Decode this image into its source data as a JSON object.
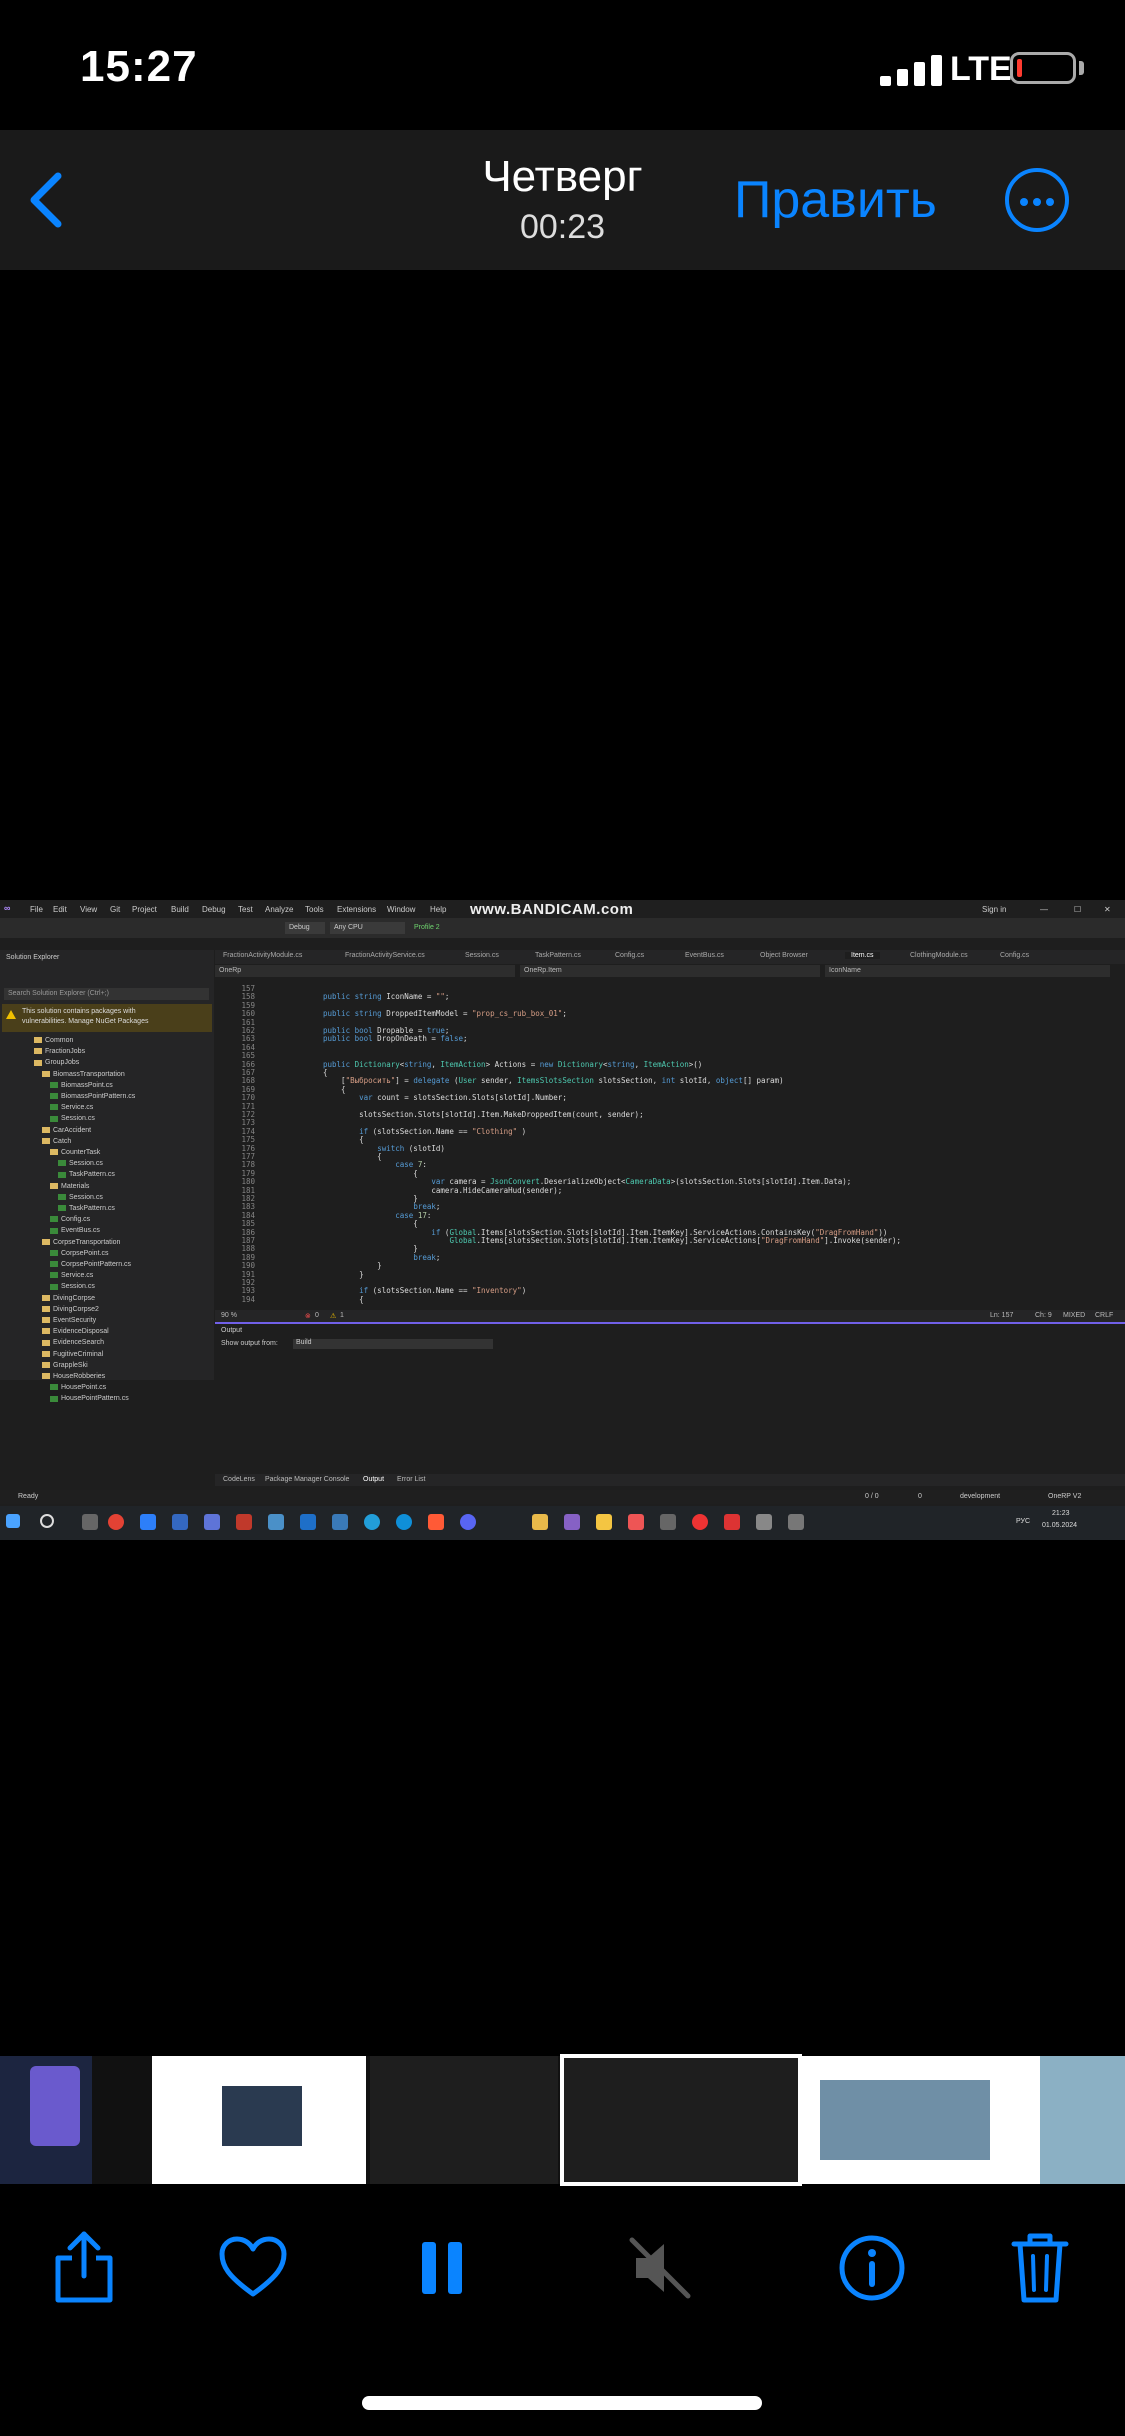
{
  "status": {
    "time": "15:27",
    "network": "LTE"
  },
  "nav": {
    "title": "Четверг",
    "subtitle": "00:23",
    "edit_label": "Править"
  },
  "video": {
    "watermark": "www.BANDICAM.com",
    "menu": [
      "File",
      "Edit",
      "View",
      "Git",
      "Project",
      "Build",
      "Debug",
      "Test",
      "Analyze",
      "Tools",
      "Extensions",
      "Window",
      "Help"
    ],
    "sign_in": "Sign in",
    "toolbar": {
      "config": "Debug",
      "platform": "Any CPU",
      "profile": "Profile 2"
    },
    "tabs": [
      "FractionActivityModule.cs",
      "FractionActivityService.cs",
      "Session.cs",
      "TaskPattern.cs",
      "Config.cs",
      "EventBus.cs",
      "Object Browser",
      "Item.cs",
      "ClothingModule.cs",
      "Config.cs"
    ],
    "active_tab": "Item.cs",
    "nav_dropdowns": [
      "OneRp",
      "OneRp.Item",
      "IconName"
    ],
    "solution": {
      "title": "Solution Explorer",
      "search": "Search Solution Explorer (Ctrl+;)",
      "warning_line1": "This solution contains packages with",
      "warning_line2": "vulnerabilities. Manage NuGet Packages",
      "items": [
        "Common",
        "FractionJobs",
        "GroupJobs",
        "BiomassTransportation",
        "BiomassPoint.cs",
        "BiomassPointPattern.cs",
        "Service.cs",
        "Session.cs",
        "CarAccident",
        "Catch",
        "CounterTask",
        "Session.cs",
        "TaskPattern.cs",
        "Materials",
        "Session.cs",
        "TaskPattern.cs",
        "Config.cs",
        "EventBus.cs",
        "CorpseTransportation",
        "CorpsePoint.cs",
        "CorpsePointPattern.cs",
        "Service.cs",
        "Session.cs",
        "DivingCorpse",
        "DivingCorpse2",
        "EventSecurity",
        "EvidenceDisposal",
        "EvidenceSearch",
        "FugitiveCriminal",
        "GrappleSki",
        "HouseRobberies",
        "HousePoint.cs",
        "HousePointPattern.cs"
      ]
    },
    "code": [
      {
        "ln": "157",
        "t": ""
      },
      {
        "ln": "158",
        "t": "public string IconName = \"\";"
      },
      {
        "ln": "159",
        "t": ""
      },
      {
        "ln": "160",
        "t": "public string DroppedItemModel = \"prop_cs_rub_box_01\";"
      },
      {
        "ln": "161",
        "t": ""
      },
      {
        "ln": "162",
        "t": "public bool Dropable = true;"
      },
      {
        "ln": "163",
        "t": "public bool DropOnDeath = false;"
      },
      {
        "ln": "164",
        "t": ""
      },
      {
        "ln": "165",
        "t": ""
      },
      {
        "ln": "166",
        "t": "public Dictionary<string, ItemAction> Actions = new Dictionary<string, ItemAction>()"
      },
      {
        "ln": "167",
        "t": "{"
      },
      {
        "ln": "168",
        "t": "    [\"Выбросить\"] = delegate (User sender, ItemsSlotsSection slotsSection, int slotId, object[] param)"
      },
      {
        "ln": "169",
        "t": "    {"
      },
      {
        "ln": "170",
        "t": "        var count = slotsSection.Slots[slotId].Number;"
      },
      {
        "ln": "171",
        "t": ""
      },
      {
        "ln": "172",
        "t": "        slotsSection.Slots[slotId].Item.MakeDroppedItem(count, sender);"
      },
      {
        "ln": "173",
        "t": ""
      },
      {
        "ln": "174",
        "t": "        if (slotsSection.Name == \"Clothing\" )"
      },
      {
        "ln": "175",
        "t": "        {"
      },
      {
        "ln": "176",
        "t": "            switch (slotId)"
      },
      {
        "ln": "177",
        "t": "            {"
      },
      {
        "ln": "178",
        "t": "                case 7:"
      },
      {
        "ln": "179",
        "t": "                    {"
      },
      {
        "ln": "180",
        "t": "                        var camera = JsonConvert.DeserializeObject<CameraData>(slotsSection.Slots[slotId].Item.Data);"
      },
      {
        "ln": "181",
        "t": "                        camera.HideCameraHud(sender);"
      },
      {
        "ln": "182",
        "t": "                    }"
      },
      {
        "ln": "183",
        "t": "                    break;"
      },
      {
        "ln": "184",
        "t": "                case 17:"
      },
      {
        "ln": "185",
        "t": "                    {"
      },
      {
        "ln": "186",
        "t": "                        if (Global.Items[slotsSection.Slots[slotId].Item.ItemKey].ServiceActions.ContainsKey(\"DragFromHand\"))"
      },
      {
        "ln": "187",
        "t": "                            Global.Items[slotsSection.Slots[slotId].Item.ItemKey].ServiceActions[\"DragFromHand\"].Invoke(sender);"
      },
      {
        "ln": "188",
        "t": "                    }"
      },
      {
        "ln": "189",
        "t": "                    break;"
      },
      {
        "ln": "190",
        "t": "            }"
      },
      {
        "ln": "191",
        "t": "        }"
      },
      {
        "ln": "192",
        "t": ""
      },
      {
        "ln": "193",
        "t": "        if (slotsSection.Name == \"Inventory\")"
      },
      {
        "ln": "194",
        "t": "        {"
      }
    ],
    "editor_status": {
      "zoom": "90 %",
      "errors": "0",
      "warnings": "1",
      "pos": "Ln: 157",
      "ch": "Ch: 9",
      "mixed": "MIXED",
      "crlf": "CRLF"
    },
    "output": {
      "title": "Output",
      "show_label": "Show output from:",
      "source": "Build"
    },
    "output_tabs": [
      "CodeLens",
      "Package Manager Console",
      "Output",
      "Error List"
    ],
    "status_bar": {
      "ready": "Ready",
      "changes": "0 / 0",
      "pencil": "0",
      "branch": "development",
      "repo": "OneRP V2"
    },
    "tray": {
      "lang": "РУС",
      "time": "21:23",
      "date": "01.05.2024"
    }
  },
  "colors": {
    "accent": "#0a84ff",
    "vs_accent": "#7160e8"
  }
}
